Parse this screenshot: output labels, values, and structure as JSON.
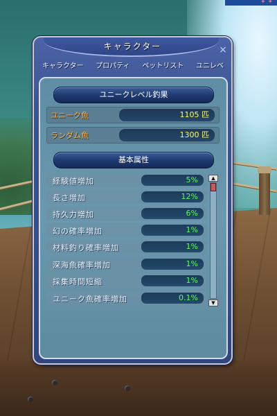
{
  "window": {
    "title": "キャラクター",
    "close_icon": "×"
  },
  "tabs": [
    {
      "label": "キャラクター"
    },
    {
      "label": "プロパティ"
    },
    {
      "label": "ペットリスト"
    },
    {
      "label": "ユニレベ"
    }
  ],
  "unique_section": {
    "header": "ユニークレベル釣果",
    "rows": [
      {
        "label": "ユニーク魚",
        "value": "1105 匹"
      },
      {
        "label": "ランダム魚",
        "value": "1300 匹"
      }
    ]
  },
  "attributes_section": {
    "header": "基本属性",
    "rows": [
      {
        "label": "経験値増加",
        "value": "5%"
      },
      {
        "label": "長さ増加",
        "value": "12%"
      },
      {
        "label": "持久力増加",
        "value": "6%"
      },
      {
        "label": "幻の確率増加",
        "value": "1%"
      },
      {
        "label": "材料釣り確率増加",
        "value": "1%"
      },
      {
        "label": "深海魚確率増加",
        "value": "1%"
      },
      {
        "label": "採集時間短縮",
        "value": "1%"
      },
      {
        "label": "ユニーク魚確率増加",
        "value": "0.1%"
      }
    ]
  },
  "scrollbar": {
    "up_icon": "▲",
    "down_icon": "▼",
    "position": 0
  },
  "colors": {
    "window_bg": "#3b5492",
    "unique_label": "#ffb040",
    "unique_value": "#ffff60",
    "attr_value": "#58ff58"
  }
}
